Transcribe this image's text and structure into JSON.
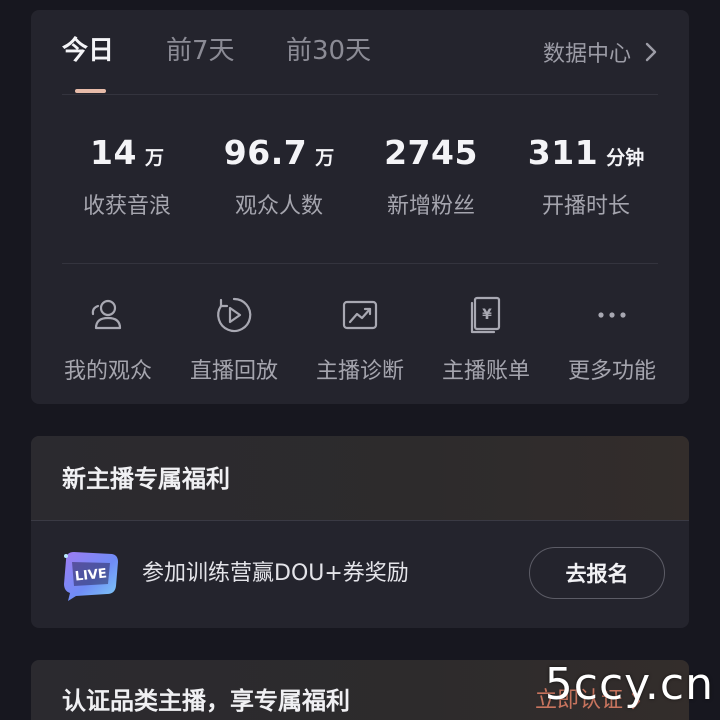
{
  "tabs": [
    {
      "label": "今日",
      "active": true
    },
    {
      "label": "前7天",
      "active": false
    },
    {
      "label": "前30天",
      "active": false
    }
  ],
  "data_center": {
    "label": "数据中心",
    "icon": "chevron-right-icon"
  },
  "metrics": [
    {
      "value": "14",
      "unit": "万",
      "label": "收获音浪"
    },
    {
      "value": "96.7",
      "unit": "万",
      "label": "观众人数"
    },
    {
      "value": "2745",
      "unit": "",
      "label": "新增粉丝"
    },
    {
      "value": "311",
      "unit": "分钟",
      "label": "开播时长"
    }
  ],
  "functions": [
    {
      "label": "我的观众",
      "icon": "audience-icon"
    },
    {
      "label": "直播回放",
      "icon": "replay-icon"
    },
    {
      "label": "主播诊断",
      "icon": "diagnosis-icon"
    },
    {
      "label": "主播账单",
      "icon": "bill-icon"
    },
    {
      "label": "更多功能",
      "icon": "more-icon"
    }
  ],
  "welfare": {
    "title": "新主播专属福利",
    "item_text": "参加训练营赢DOU+券奖励",
    "badge_text": "LIVE",
    "button_label": "去报名"
  },
  "certify": {
    "title": "认证品类主播，享专属福利",
    "link_label": "立即认证"
  },
  "watermark": "5ccy.cn",
  "colors": {
    "background": "#17171f",
    "card": "#24242d",
    "tab_indicator": "#e7bba9",
    "link_accent": "#c8745e"
  }
}
